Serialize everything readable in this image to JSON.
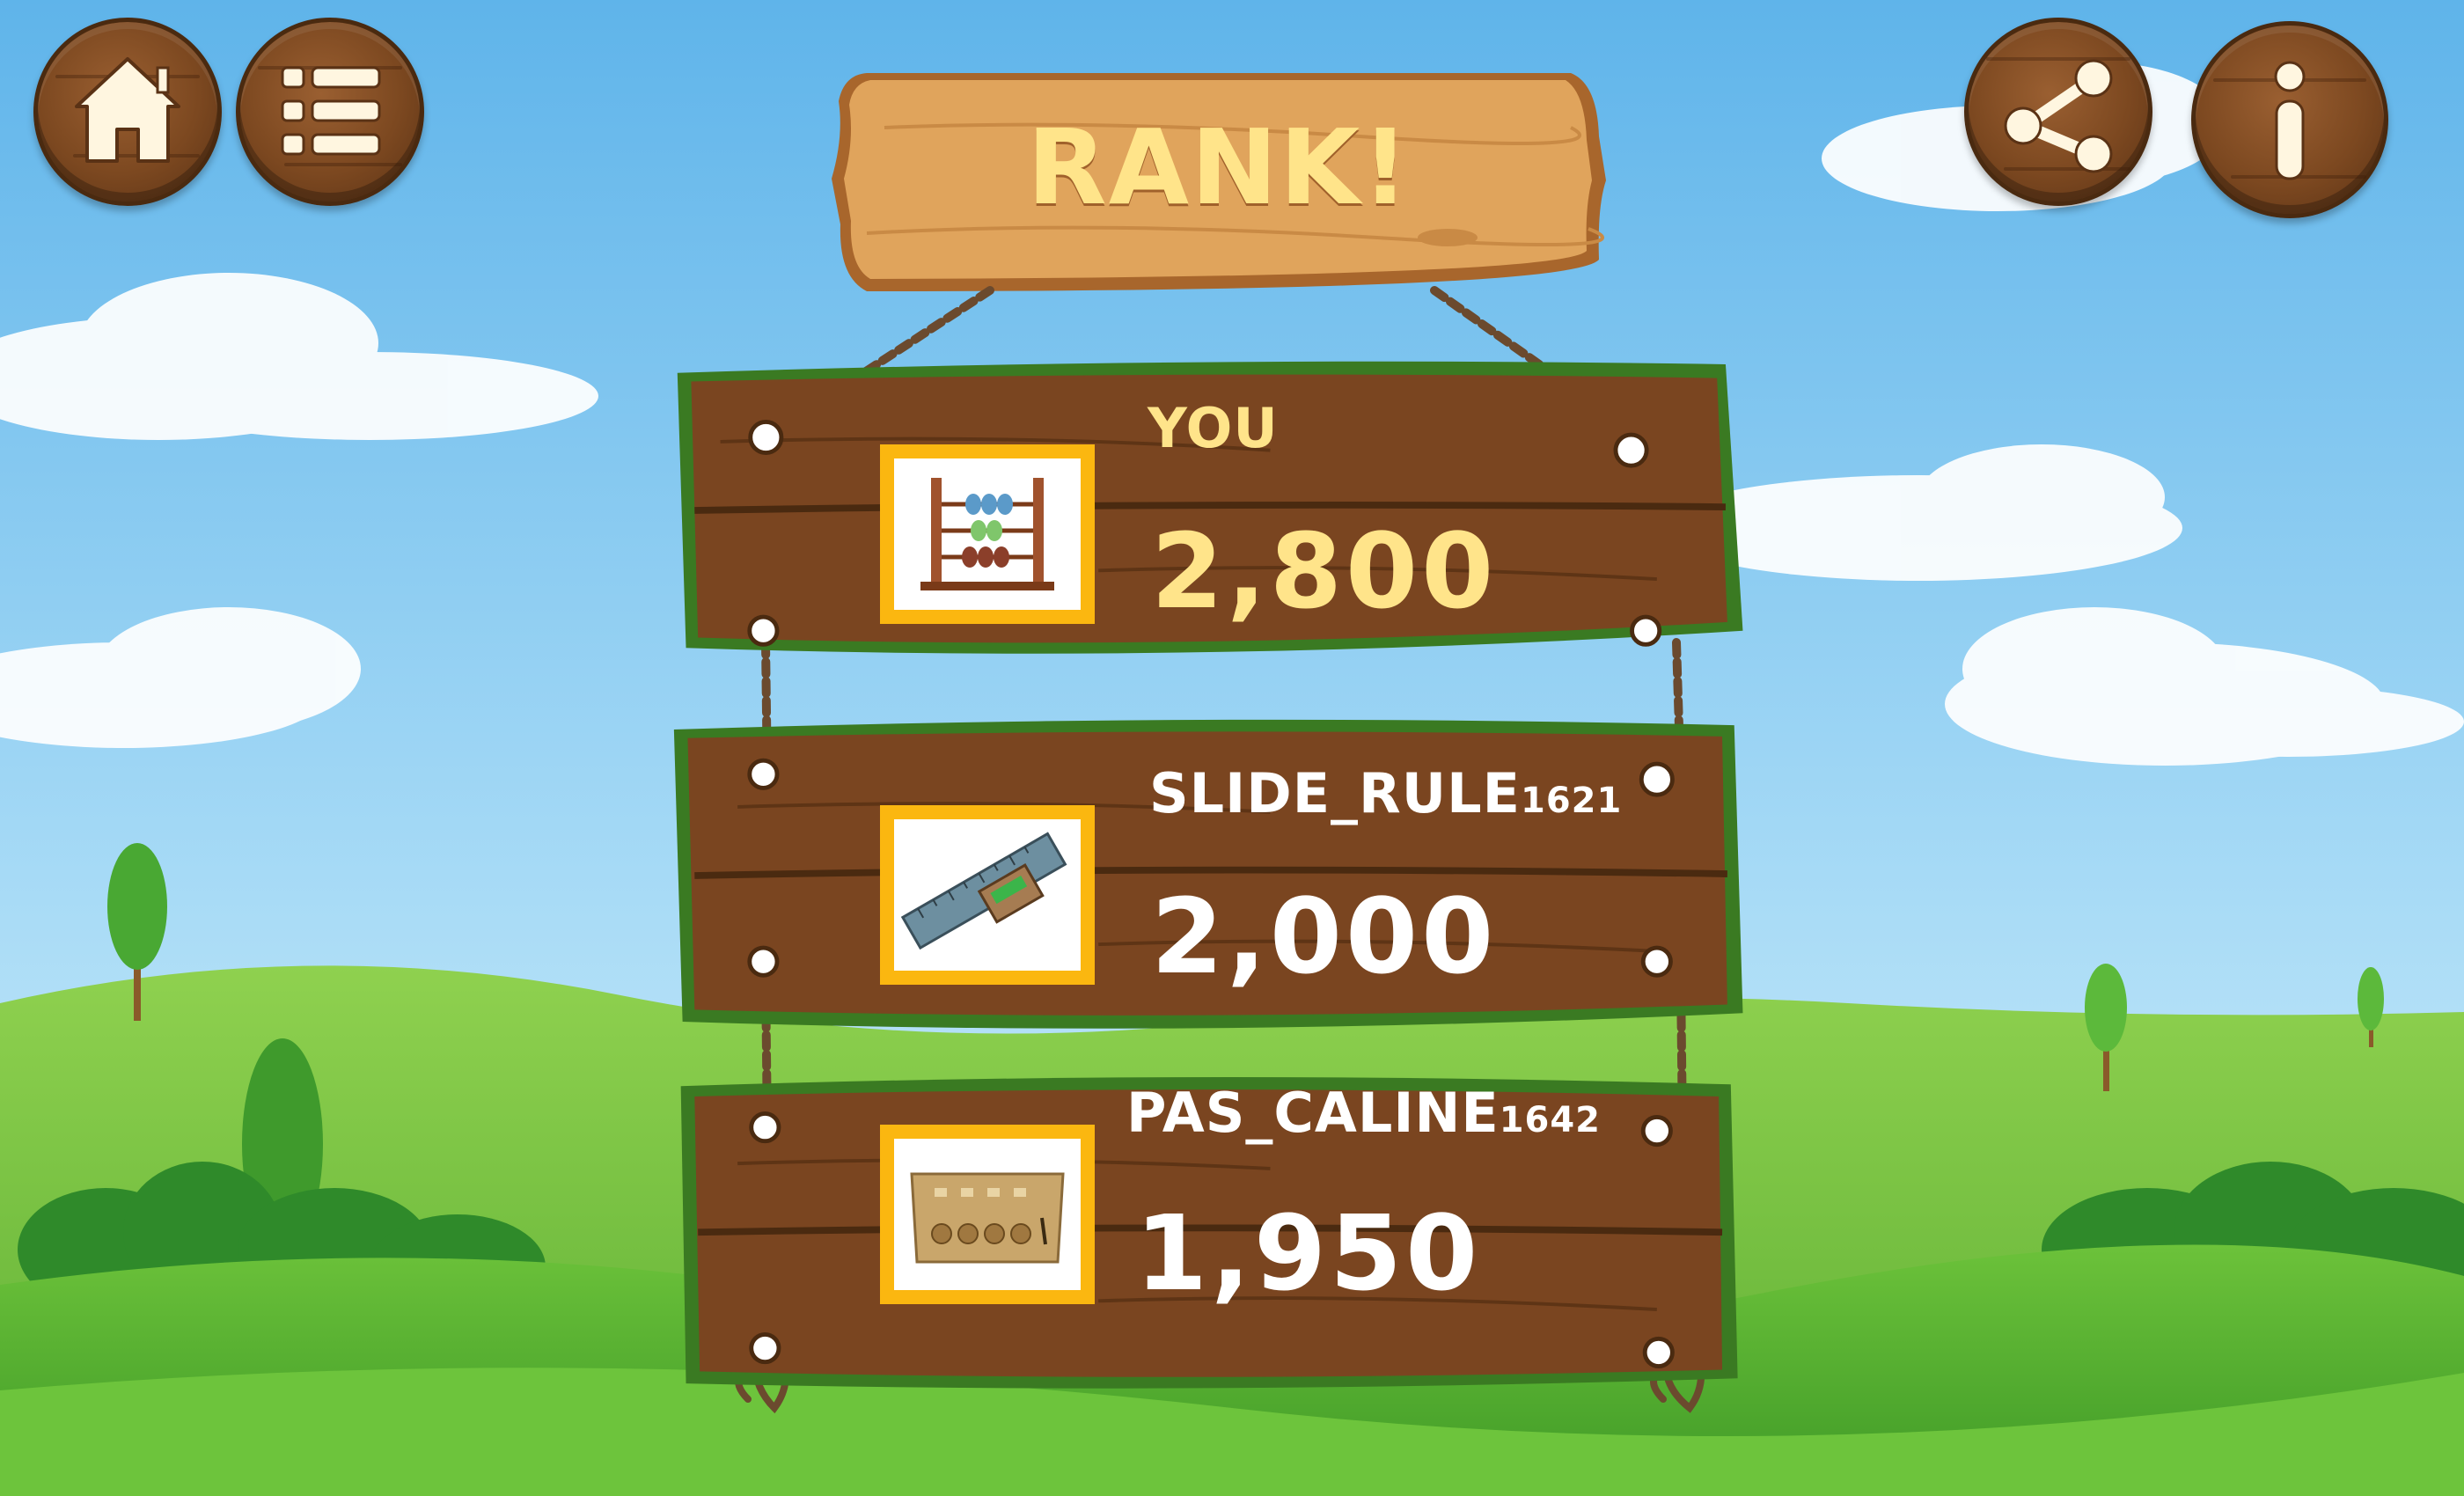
{
  "title": "RANK!",
  "toolbar": {
    "home_icon": "home-icon",
    "list_icon": "list-icon",
    "share_icon": "share-icon",
    "info_icon": "info-icon"
  },
  "leaderboard": [
    {
      "name": "YOU",
      "name_suffix": "",
      "score": "2,800",
      "avatar_icon": "abacus-icon",
      "name_color": "#ffe48a",
      "score_color": "#ffe48a"
    },
    {
      "name": "SLIDE_RULE",
      "name_suffix": "1621",
      "score": "2,000",
      "avatar_icon": "slide-rule-icon",
      "name_color": "#ffffff",
      "score_color": "#ffffff"
    },
    {
      "name": "PAS_CALINE",
      "name_suffix": "1642",
      "score": "1,950",
      "avatar_icon": "pascaline-icon",
      "name_color": "#ffffff",
      "score_color": "#ffffff"
    }
  ],
  "colors": {
    "sky": "#8ccbf2",
    "grass": "#6cbf3a",
    "wood": "#7a4520",
    "accent_yellow": "#fbb710"
  }
}
